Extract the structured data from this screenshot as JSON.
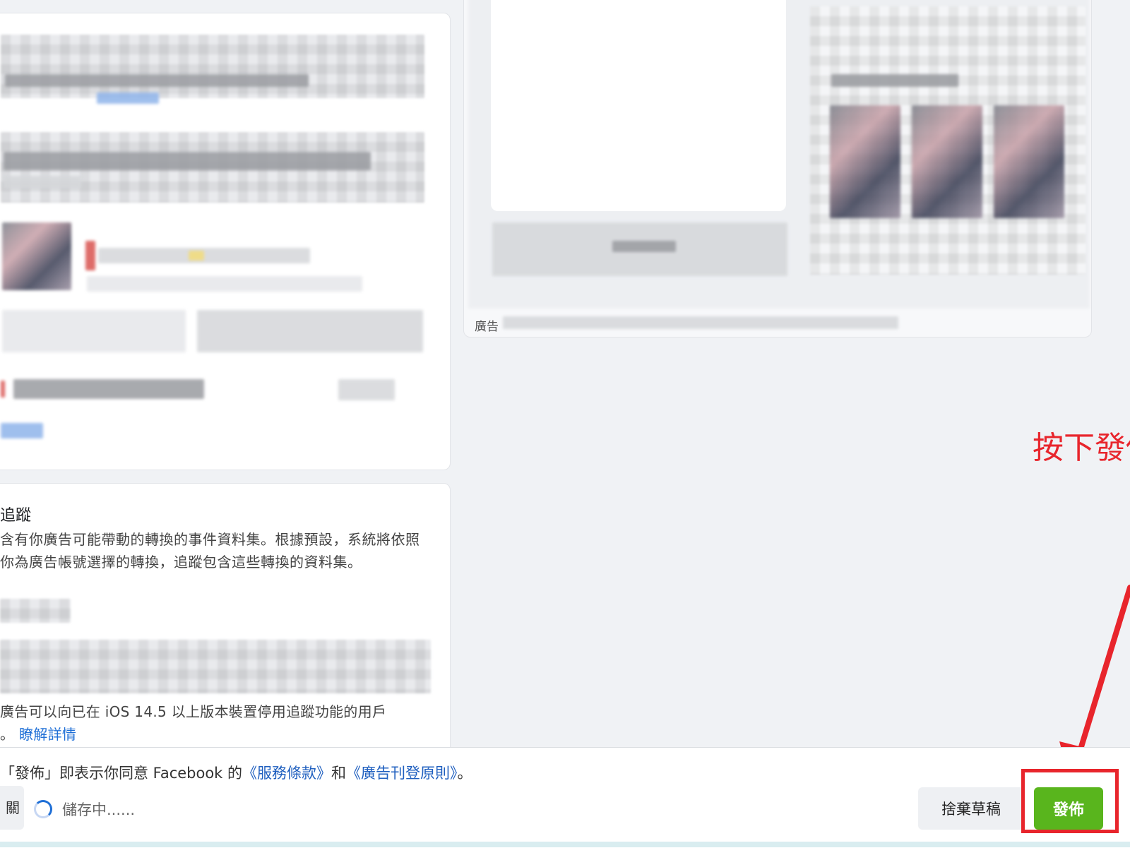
{
  "tracking": {
    "title": "追蹤",
    "description": "含有你廣告可能帶動的轉換的事件資料集。根據預設，系統將依照你為廣告帳號選擇的轉換，追蹤包含這些轉換的資料集。",
    "ios_note": "廣告可以向已在 iOS 14.5 以上版本裝置停用追蹤功能的用戶",
    "ios_note_tail": "。",
    "learn_more": "瞭解詳情"
  },
  "preview": {
    "caption": "廣告"
  },
  "annotation": {
    "text": "按下發佈",
    "color": "#e8252c"
  },
  "footer": {
    "terms_prefix": "「發佈」即表示你同意 Facebook 的",
    "terms_link1": "《服務條款》",
    "terms_and": "和",
    "terms_link2": "《廣告刊登原則》",
    "terms_suffix": "。",
    "prev_label": "關",
    "saving_status": "儲存中......",
    "discard_label": "捨棄草稿",
    "publish_label": "發佈",
    "publish_color": "#59b51d"
  }
}
